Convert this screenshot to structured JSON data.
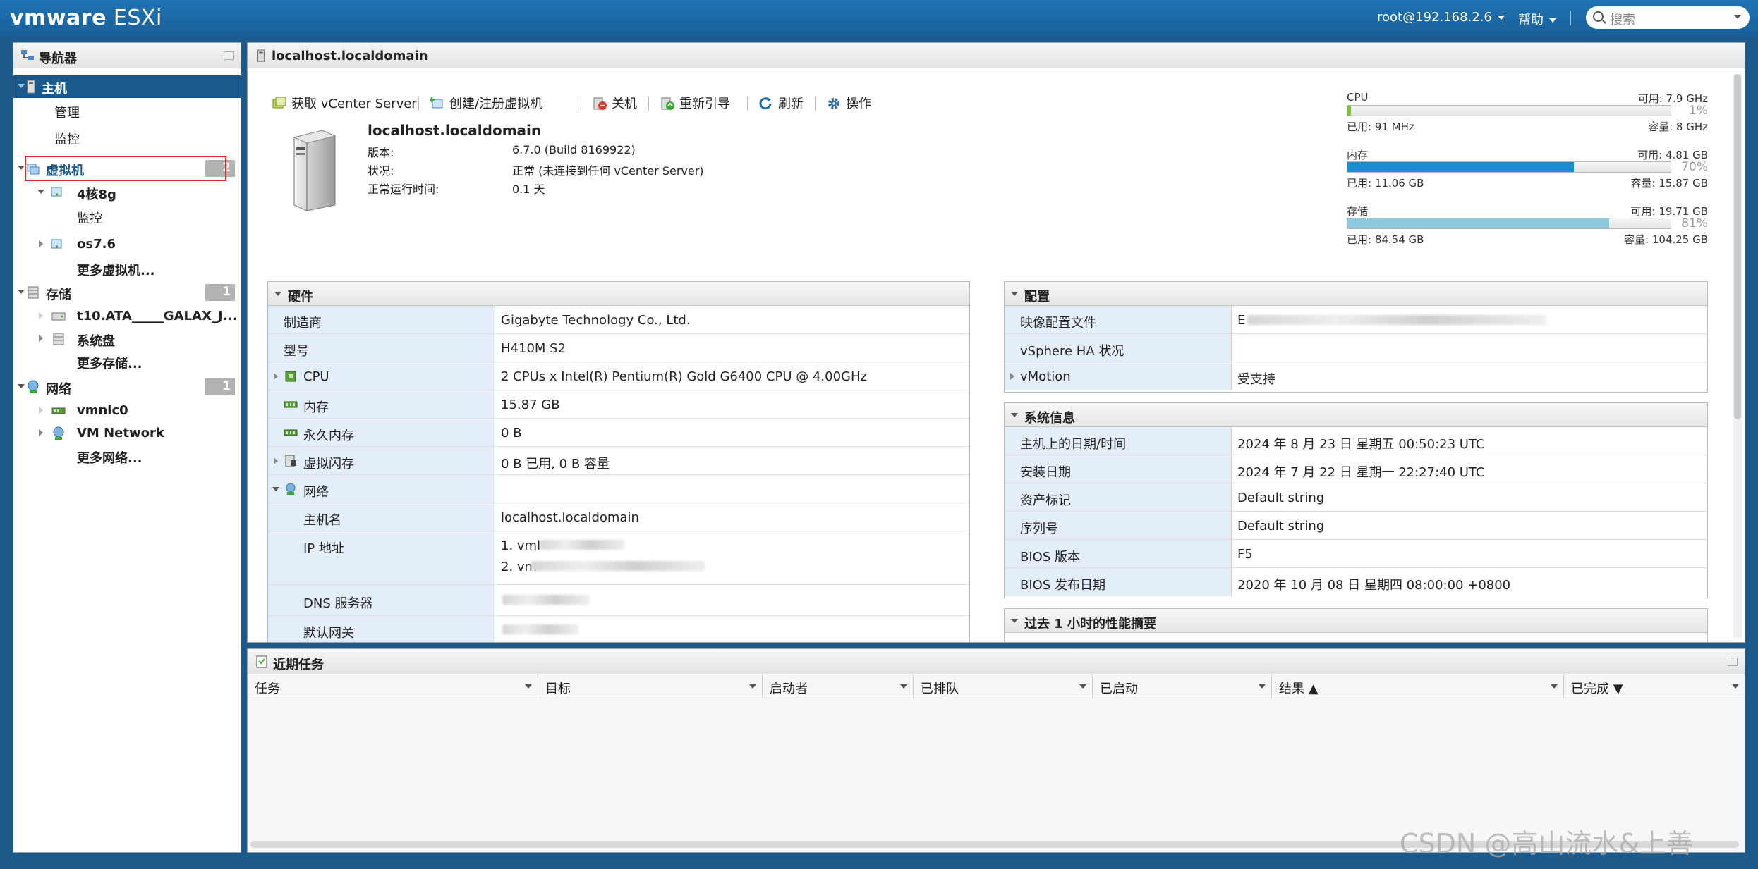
{
  "topbar": {
    "brand": "vmware",
    "product": "ESXi",
    "user": "root@192.168.2.6",
    "help": "帮助",
    "search_placeholder": "搜索"
  },
  "navigator": {
    "title": "导航器",
    "host": "主机",
    "host_children": [
      "管理",
      "监控"
    ],
    "vms": {
      "label": "虚拟机",
      "count": "2"
    },
    "vm1": "4核8g",
    "vm1_child": "监控",
    "vm2": "os7.6",
    "more_vms": "更多虚拟机...",
    "storage": {
      "label": "存储",
      "count": "1"
    },
    "storage_items": [
      "t10.ATA_____GALAX_J...",
      "系统盘"
    ],
    "more_storage": "更多存储...",
    "network": {
      "label": "网络",
      "count": "1"
    },
    "network_items": [
      "vmnic0",
      "VM Network"
    ],
    "more_network": "更多网络..."
  },
  "main": {
    "tab_title": "localhost.localdomain",
    "toolbar": [
      "获取 vCenter Server",
      "创建/注册虚拟机",
      "关机",
      "重新引导",
      "刷新",
      "操作"
    ],
    "host_name": "localhost.localdomain",
    "summary": [
      {
        "label": "版本:",
        "value": "6.7.0 (Build 8169922)"
      },
      {
        "label": "状况:",
        "value": "正常 (未连接到任何 vCenter Server)"
      },
      {
        "label": "正常运行时间:",
        "value": "0.1 天"
      }
    ],
    "resources": [
      {
        "name": "CPU",
        "free": "可用: 7.9 GHz",
        "pct": "1%",
        "used": "已用: 91 MHz",
        "capacity": "容量: 8 GHz",
        "fraction": 0.01,
        "color": "#7ec241"
      },
      {
        "name": "内存",
        "free": "可用: 4.81 GB",
        "pct": "70%",
        "used": "已用: 11.06 GB",
        "capacity": "容量: 15.87 GB",
        "fraction": 0.7,
        "color": "#1a8ed0"
      },
      {
        "name": "存储",
        "free": "可用: 19.71 GB",
        "pct": "81%",
        "used": "已用: 84.54 GB",
        "capacity": "容量: 104.25 GB",
        "fraction": 0.81,
        "color": "#8ec8dc"
      }
    ],
    "hardware": {
      "title": "硬件",
      "rows": [
        {
          "label": "制造商",
          "value": "Gigabyte Technology Co., Ltd."
        },
        {
          "label": "型号",
          "value": "H410M S2"
        },
        {
          "label": "CPU",
          "value": "2 CPUs x Intel(R) Pentium(R) Gold G6400 CPU @ 4.00GHz"
        },
        {
          "label": "内存",
          "value": "15.87 GB"
        },
        {
          "label": "永久内存",
          "value": "0 B"
        },
        {
          "label": "虚拟闪存",
          "value": "0 B 已用, 0 B 容量"
        },
        {
          "label": "网络",
          "value": ""
        },
        {
          "label": "主机名",
          "value": "localhost.localdomain"
        },
        {
          "label": "IP 地址",
          "value1": "1. vml",
          "value2": "2. vm"
        },
        {
          "label": "DNS 服务器",
          "value": ""
        },
        {
          "label": "默认网关",
          "value": ""
        }
      ]
    },
    "config": {
      "title": "配置",
      "rows": [
        {
          "label": "映像配置文件",
          "value": "E"
        },
        {
          "label": "vSphere HA 状况",
          "value": ""
        },
        {
          "label": "vMotion",
          "value": "受支持"
        }
      ]
    },
    "sysinfo": {
      "title": "系统信息",
      "rows": [
        {
          "label": "主机上的日期/时间",
          "value": "2024 年 8 月 23 日 星期五 00:50:23 UTC"
        },
        {
          "label": "安装日期",
          "value": "2024 年 7 月 22 日 星期一 22:27:40 UTC"
        },
        {
          "label": "资产标记",
          "value": "Default string"
        },
        {
          "label": "序列号",
          "value": "Default string"
        },
        {
          "label": "BIOS 版本",
          "value": "F5"
        },
        {
          "label": "BIOS 发布日期",
          "value": "2020 年 10 月 08 日 星期四 08:00:00 +0800"
        }
      ]
    },
    "perf_title": "过去 1 小时的性能摘要"
  },
  "tasks": {
    "title": "近期任务",
    "columns": [
      "任务",
      "目标",
      "启动者",
      "已排队",
      "已启动",
      "结果 ▲",
      "已完成 ▼"
    ]
  },
  "watermark": "CSDN @高山流水&上善"
}
